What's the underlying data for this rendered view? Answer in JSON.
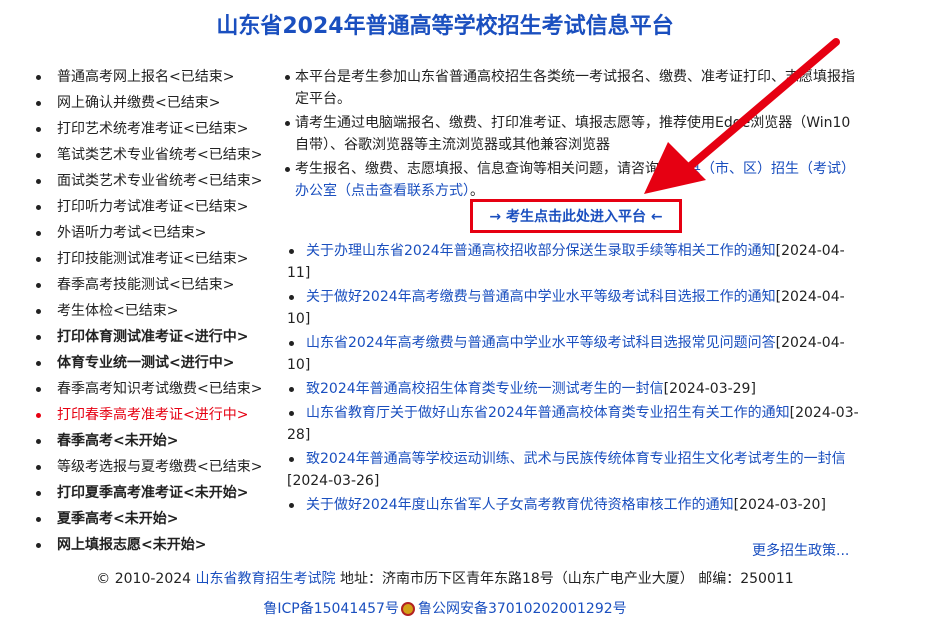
{
  "page_title": "山东省2024年普通高等学校招生考试信息平台",
  "left_menu": [
    {
      "label": "普通高考网上报名<已结束>",
      "style": "normal"
    },
    {
      "label": "网上确认并缴费<已结束>",
      "style": "normal"
    },
    {
      "label": "打印艺术统考准考证<已结束>",
      "style": "normal"
    },
    {
      "label": "笔试类艺术专业省统考<已结束>",
      "style": "normal"
    },
    {
      "label": "面试类艺术专业省统考<已结束>",
      "style": "normal"
    },
    {
      "label": "打印听力考试准考证<已结束>",
      "style": "normal"
    },
    {
      "label": "外语听力考试<已结束>",
      "style": "normal"
    },
    {
      "label": "打印技能测试准考证<已结束>",
      "style": "normal"
    },
    {
      "label": "春季高考技能测试<已结束>",
      "style": "normal"
    },
    {
      "label": "考生体检<已结束>",
      "style": "normal"
    },
    {
      "label": "打印体育测试准考证<进行中>",
      "style": "bold"
    },
    {
      "label": "体育专业统一测试<进行中>",
      "style": "bold"
    },
    {
      "label": "春季高考知识考试缴费<已结束>",
      "style": "normal"
    },
    {
      "label": "打印春季高考准考证<进行中>",
      "style": "red"
    },
    {
      "label": "春季高考<未开始>",
      "style": "bold"
    },
    {
      "label": "等级考选报与夏考缴费<已结束>",
      "style": "normal"
    },
    {
      "label": "打印夏季高考准考证<未开始>",
      "style": "bold"
    },
    {
      "label": "夏季高考<未开始>",
      "style": "bold"
    },
    {
      "label": "网上填报志愿<未开始>",
      "style": "bold"
    }
  ],
  "notes": {
    "n1": "本平台是考生参加山东省普通高校招生各类统一考试报名、缴费、准考证打印、志愿填报指定平台。",
    "n2": "请考生通过电脑端报名、缴费、打印准考证、填报志愿等，推荐使用Edge浏览器（Win10自带）、谷歌浏览器等主流浏览器或其他兼容浏览器",
    "n3_text": "考生报名、缴费、志愿填报、信息查询等相关问题，请咨询",
    "n3_link": "报名县（市、区）招生（考试）办公室（点击查看联系方式）",
    "n3_end": "。"
  },
  "enter_button": "→ 考生点击此处进入平台 ←",
  "news": [
    {
      "title": "关于办理山东省2024年普通高校招收部分保送生录取手续等相关工作的通知",
      "date": "[2024-04-11]"
    },
    {
      "title": "关于做好2024年高考缴费与普通高中学业水平等级考试科目选报工作的通知",
      "date": "[2024-04-10]"
    },
    {
      "title": "山东省2024年高考缴费与普通高中学业水平等级考试科目选报常见问题问答",
      "date": "[2024-04-10]"
    },
    {
      "title": "致2024年普通高校招生体育类专业统一测试考生的一封信",
      "date": "[2024-03-29]"
    },
    {
      "title": "山东省教育厅关于做好山东省2024年普通高校体育类专业招生有关工作的通知",
      "date": "[2024-03-28]"
    },
    {
      "title": "致2024年普通高等学校运动训练、武术与民族传统体育专业招生文化考试考生的一封信",
      "date": "[2024-03-26]"
    },
    {
      "title": "关于做好2024年度山东省军人子女高考教育优待资格审核工作的通知",
      "date": "[2024-03-20]"
    }
  ],
  "more_link": "更多招生政策...",
  "footer": {
    "copyright": "© 2010-2024 ",
    "org_link": "山东省教育招生考试院",
    "address": " 地址：济南市历下区青年东路18号（山东广电产业大厦） 邮编：250011",
    "icp": "鲁ICP备15041457号",
    "police": "鲁公网安备37010202001292号"
  },
  "colors": {
    "accent": "#1a4fbf",
    "highlight": "#e60012"
  }
}
